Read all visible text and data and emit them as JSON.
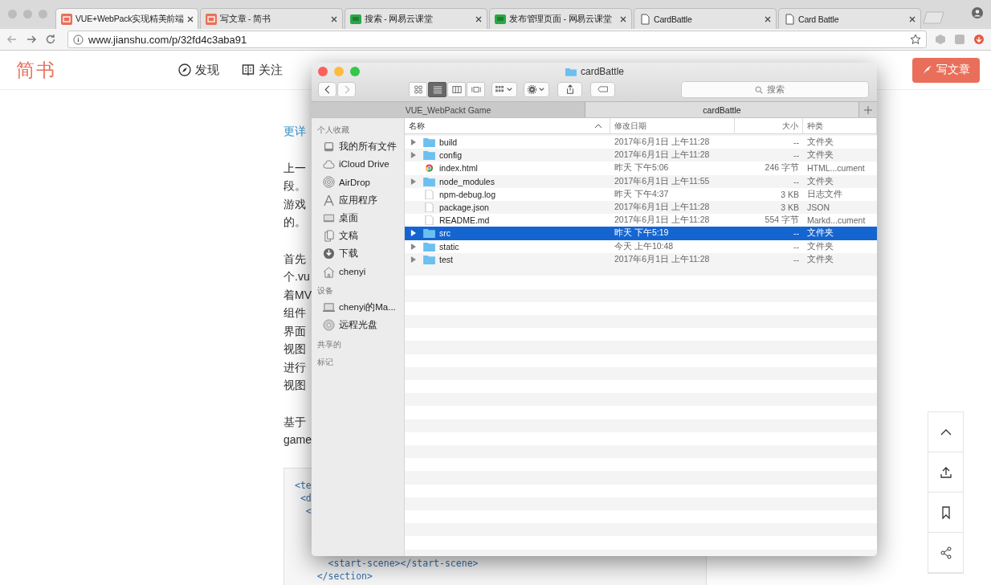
{
  "browser": {
    "tabs": [
      {
        "title": "VUE+WebPack实现精美前端",
        "kind": "jianshu",
        "selected": true
      },
      {
        "title": "写文章 - 简书",
        "kind": "jianshu",
        "selected": false
      },
      {
        "title": "搜索 - 网易云课堂",
        "kind": "netease",
        "selected": false
      },
      {
        "title": "发布管理页面 - 网易云课堂",
        "kind": "netease",
        "selected": false
      },
      {
        "title": "CardBattle",
        "kind": "page",
        "selected": false
      },
      {
        "title": "Card Battle",
        "kind": "page",
        "selected": false
      }
    ],
    "url": "www.jianshu.com/p/32fd4c3aba91"
  },
  "page": {
    "logo": "简书",
    "nav": [
      {
        "label": "发现"
      },
      {
        "label": "关注"
      }
    ],
    "write_button": "写文章",
    "paragraphs": [
      {
        "kind": "link",
        "lines": [
          "更详"
        ]
      },
      {
        "kind": "text",
        "lines": [
          "上一",
          "段。",
          "游戏",
          "的。"
        ]
      },
      {
        "kind": "text",
        "lines": [
          "首先",
          "个.vu",
          "着MV",
          "组件",
          "界面",
          "视图",
          "进行",
          "视图"
        ]
      },
      {
        "kind": "text",
        "lines": [
          "基于",
          "game"
        ]
      }
    ],
    "code_top": [
      "<te",
      " <d",
      "  <"
    ],
    "code_bottom": [
      "      <start-scene></start-scene>",
      "    </section>"
    ]
  },
  "finder": {
    "title": "cardBattle",
    "views": [
      {
        "selected": false
      },
      {
        "selected": true
      },
      {
        "selected": false
      },
      {
        "selected": false
      }
    ],
    "search": {
      "placeholder": "搜索"
    },
    "tabs": [
      {
        "label": "VUE_WebPackt Game",
        "selected": false
      },
      {
        "label": "cardBattle",
        "selected": true
      }
    ],
    "sidebar": [
      {
        "heading": "个人收藏",
        "items": [
          {
            "label": "我的所有文件"
          },
          {
            "label": "iCloud Drive"
          },
          {
            "label": "AirDrop"
          },
          {
            "label": "应用程序"
          },
          {
            "label": "桌面"
          },
          {
            "label": "文稿"
          },
          {
            "label": "下载"
          },
          {
            "label": "chenyi"
          }
        ]
      },
      {
        "heading": "设备",
        "items": [
          {
            "label": "chenyi的Ma..."
          },
          {
            "label": "远程光盘"
          }
        ]
      },
      {
        "heading": "共享的"
      },
      {
        "heading": "标记"
      }
    ],
    "columns": [
      "名称",
      "修改日期",
      "大小",
      "种类"
    ],
    "rows": [
      {
        "name": "build",
        "kind": "folder",
        "date": "2017年6月1日 上午11:28",
        "size": "--",
        "type": "文件夹",
        "selected": false
      },
      {
        "name": "config",
        "kind": "folder",
        "date": "2017年6月1日 上午11:28",
        "size": "--",
        "type": "文件夹",
        "selected": false
      },
      {
        "name": "index.html",
        "kind": "html",
        "date": "昨天 下午5:06",
        "size": "246 字节",
        "type": "HTML...cument",
        "selected": false
      },
      {
        "name": "node_modules",
        "kind": "folder",
        "date": "2017年6月1日 上午11:55",
        "size": "--",
        "type": "文件夹",
        "selected": false
      },
      {
        "name": "npm-debug.log",
        "kind": "file",
        "date": "昨天 下午4:37",
        "size": "3 KB",
        "type": "日志文件",
        "selected": false
      },
      {
        "name": "package.json",
        "kind": "file",
        "date": "2017年6月1日 上午11:28",
        "size": "3 KB",
        "type": "JSON",
        "selected": false
      },
      {
        "name": "README.md",
        "kind": "file",
        "date": "2017年6月1日 上午11:28",
        "size": "554 字节",
        "type": "Markd...cument",
        "selected": false
      },
      {
        "name": "src",
        "kind": "folder",
        "date": "昨天 下午5:19",
        "size": "--",
        "type": "文件夹",
        "selected": true
      },
      {
        "name": "static",
        "kind": "folder",
        "date": "今天 上午10:48",
        "size": "--",
        "type": "文件夹",
        "selected": false
      },
      {
        "name": "test",
        "kind": "folder",
        "date": "2017年6月1日 上午11:28",
        "size": "--",
        "type": "文件夹",
        "selected": false
      }
    ]
  }
}
